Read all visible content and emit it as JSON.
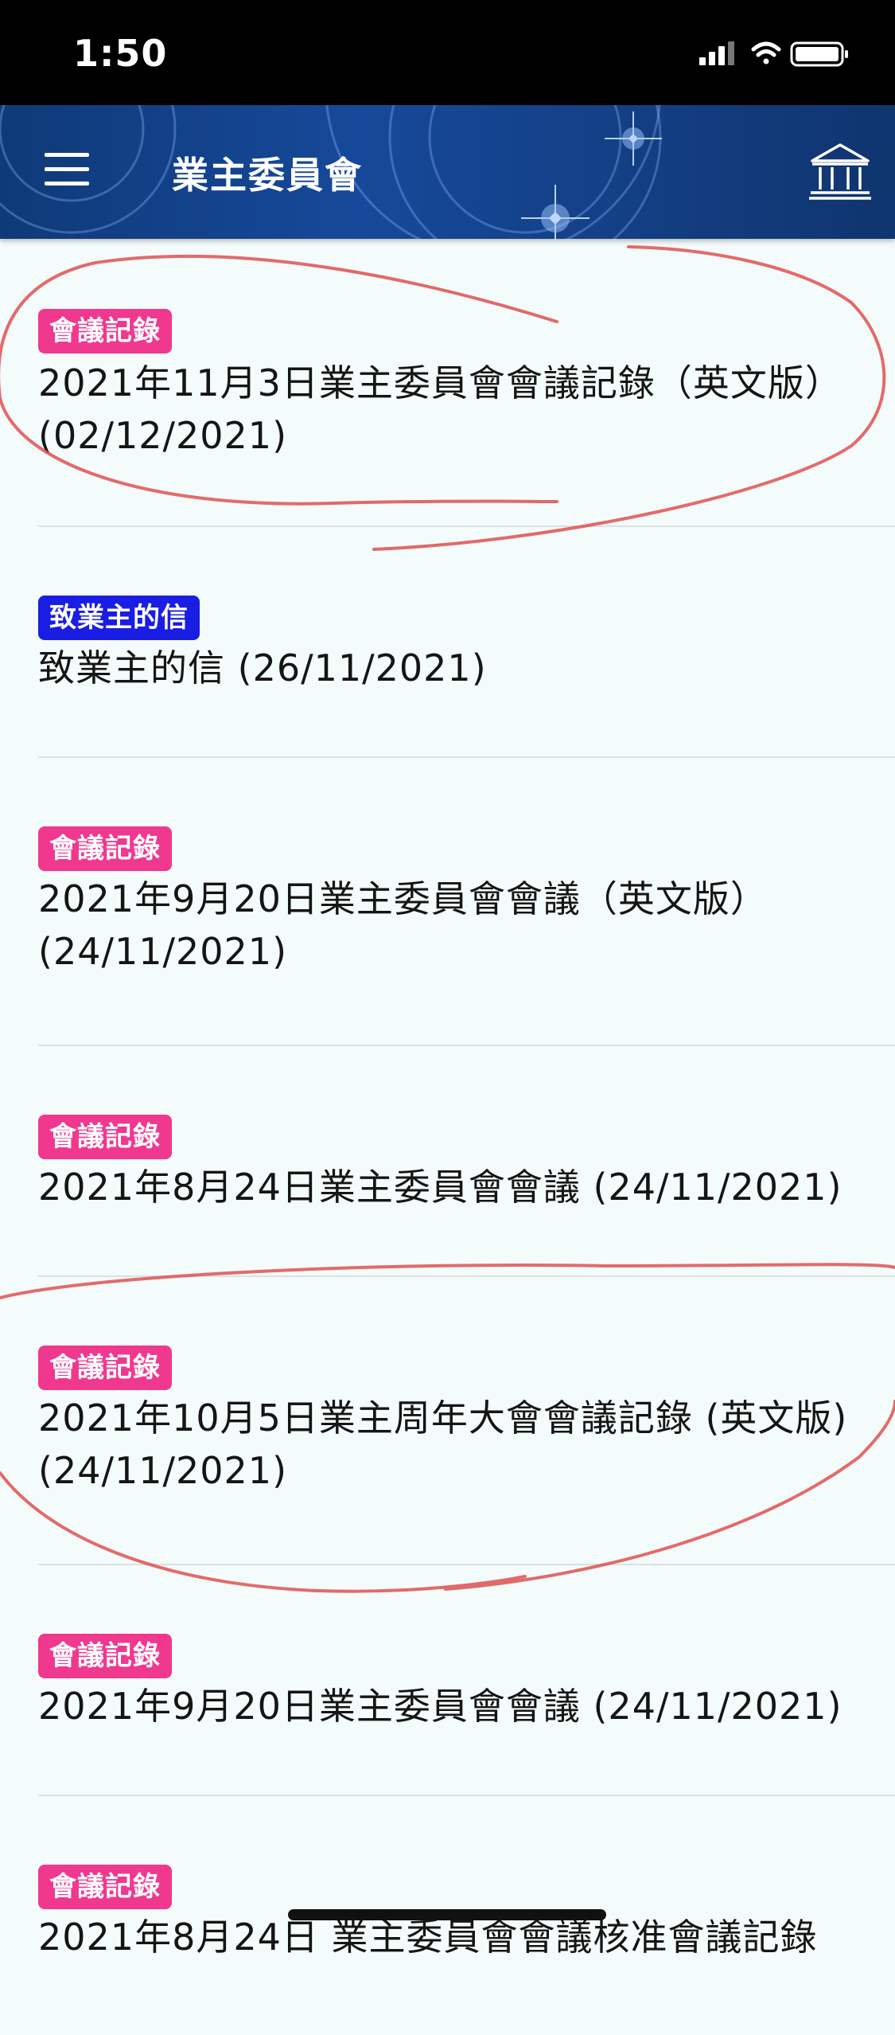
{
  "status_bar": {
    "time": "1:50",
    "icons": [
      "cellular-signal-icon",
      "wifi-icon",
      "battery-icon"
    ]
  },
  "header": {
    "title": "業主委員會",
    "left_icon": "hamburger-menu-icon",
    "right_icon": "building-home-icon"
  },
  "colors": {
    "badge_minutes": "#f0388e",
    "badge_letter": "#1a1de3",
    "header": "#16499a",
    "annotation": "#e05050"
  },
  "items": [
    {
      "category": "會議記錄",
      "title": "2021年11月3日業主委員會會議記錄（英文版）(02/12/2021)"
    },
    {
      "category": "致業主的信",
      "title": "致業主的信 (26/11/2021)"
    },
    {
      "category": "會議記錄",
      "title": "2021年9月20日業主委員會會議（英文版）(24/11/2021)"
    },
    {
      "category": "會議記錄",
      "title": "2021年8月24日業主委員會會議 (24/11/2021)"
    },
    {
      "category": "會議記錄",
      "title": "2021年10月5日業主周年大會會議記錄 (英文版) (24/11/2021)"
    },
    {
      "category": "會議記錄",
      "title": "2021年9月20日業主委員會會議 (24/11/2021)"
    },
    {
      "category": "會議記錄",
      "title": "2021年8月24日 業主委員會會議核准會議記錄"
    }
  ]
}
